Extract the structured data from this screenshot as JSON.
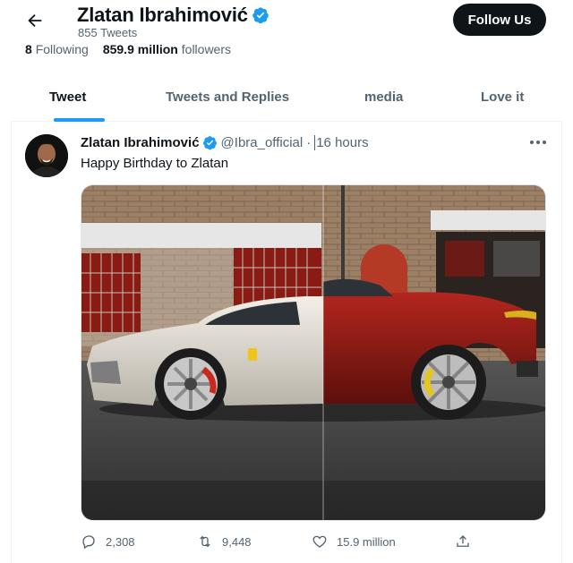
{
  "header": {
    "display_name": "Zlatan Ibrahimović",
    "tweet_count": "855 Tweets",
    "following_count": "8",
    "following_label": "Following",
    "followers_count": "859.9 million",
    "followers_label": "followers",
    "follow_button": "Follow Us"
  },
  "tabs": [
    {
      "label": "Tweet",
      "active": true
    },
    {
      "label": "Tweets and Replies",
      "active": false
    },
    {
      "label": "media",
      "active": false
    },
    {
      "label": "Love it",
      "active": false
    }
  ],
  "tweet": {
    "author": "Zlatan Ibrahimović",
    "handle": "@Ibra_official",
    "separator": "·",
    "time": "16 hours",
    "text": "Happy Birthday to Zlatan",
    "replies": "2,308",
    "retweets": "9,448",
    "likes": "15.9 million"
  },
  "icons": {
    "back": "arrow-left-icon",
    "verified": "verified-badge-icon",
    "more": "more-horizontal-icon",
    "reply": "reply-icon",
    "retweet": "retweet-icon",
    "like": "heart-icon",
    "share": "share-icon"
  },
  "colors": {
    "accent": "#1d9bf0",
    "text_primary": "#0f1419",
    "text_secondary": "#536471",
    "follow_button_bg": "#0f1419"
  }
}
